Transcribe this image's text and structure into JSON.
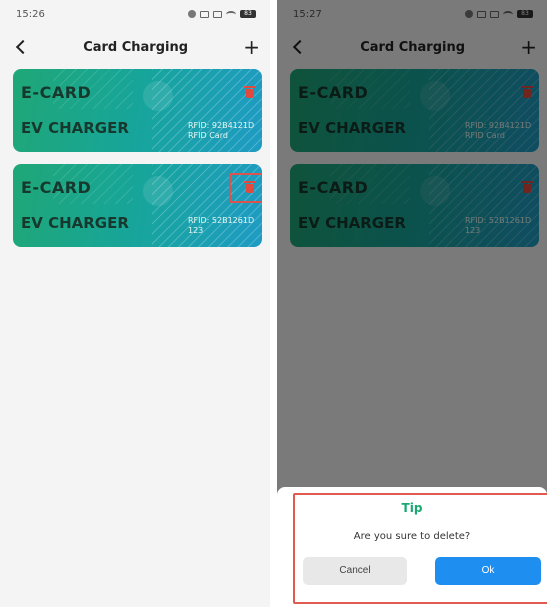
{
  "left_screen": {
    "status": {
      "time": "15:26",
      "battery": "83"
    },
    "nav": {
      "title": "Card Charging",
      "plus": "+"
    },
    "cards": [
      {
        "brand": "E-CARD",
        "product": "EV CHARGER",
        "rfid": "RFID: 92B4121D",
        "name": "RFID Card"
      },
      {
        "brand": "E-CARD",
        "product": "EV CHARGER",
        "rfid": "RFID: 52B1261D",
        "name": "123"
      }
    ]
  },
  "right_screen": {
    "status": {
      "time": "15:27",
      "battery": "83"
    },
    "nav": {
      "title": "Card Charging",
      "plus": "+"
    },
    "cards": [
      {
        "brand": "E-CARD",
        "product": "EV CHARGER",
        "rfid": "RFID: 92B4121D",
        "name": "RFID Card"
      },
      {
        "brand": "E-CARD",
        "product": "EV CHARGER",
        "rfid": "RFID: 52B1261D",
        "name": "123"
      }
    ],
    "dialog": {
      "title": "Tip",
      "message": "Are you sure to delete?",
      "cancel_label": "Cancel",
      "ok_label": "Ok"
    }
  },
  "icons": {
    "back": "chevron-left-icon",
    "add": "plus-icon",
    "delete": "trash-icon"
  },
  "colors": {
    "card_start": "#1fa776",
    "card_end": "#1e9bc4",
    "delete_red": "#e04a3f",
    "tip_green": "#18a870",
    "ok_blue": "#1e8ff0",
    "highlight_red": "#d9534f"
  }
}
